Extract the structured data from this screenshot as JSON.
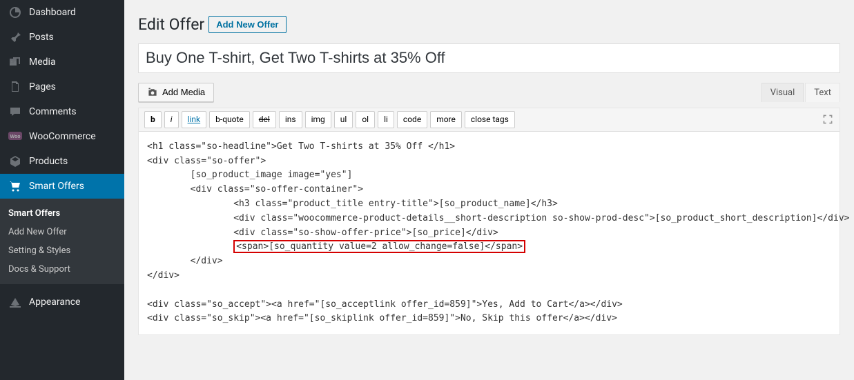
{
  "sidebar": {
    "items": [
      {
        "label": "Dashboard",
        "icon": "dashboard-icon"
      },
      {
        "label": "Posts",
        "icon": "pin-icon"
      },
      {
        "label": "Media",
        "icon": "media-icon"
      },
      {
        "label": "Pages",
        "icon": "pages-icon"
      },
      {
        "label": "Comments",
        "icon": "comments-icon"
      },
      {
        "label": "WooCommerce",
        "icon": "woo-icon"
      },
      {
        "label": "Products",
        "icon": "products-icon"
      },
      {
        "label": "Smart Offers",
        "icon": "cart-icon"
      },
      {
        "label": "Appearance",
        "icon": "appearance-icon"
      }
    ],
    "subitems": [
      {
        "label": "Smart Offers"
      },
      {
        "label": "Add New Offer"
      },
      {
        "label": "Setting & Styles"
      },
      {
        "label": "Docs & Support"
      }
    ]
  },
  "page": {
    "heading": "Edit Offer",
    "add_new": "Add New Offer",
    "title_value": "Buy One T-shirt, Get Two T-shirts at 35% Off",
    "add_media": "Add Media"
  },
  "editor": {
    "tabs": {
      "visual": "Visual",
      "text": "Text"
    },
    "quicktags": [
      "b",
      "i",
      "link",
      "b-quote",
      "del",
      "ins",
      "img",
      "ul",
      "ol",
      "li",
      "code",
      "more",
      "close tags"
    ],
    "content_lines": {
      "l1": "<h1 class=\"so-headline\">Get Two T-shirts at 35% Off </h1>",
      "l2": "<div class=\"so-offer\">",
      "l3": "        [so_product_image image=\"yes\"]",
      "l4": "        <div class=\"so-offer-container\">",
      "l5": "                <h3 class=\"product_title entry-title\">[so_product_name]</h3>",
      "l6": "                <div class=\"woocommerce-product-details__short-description so-show-prod-desc\">[so_product_short_description]</div>",
      "l7": "                <div class=\"so-show-offer-price\">[so_price]</div>",
      "l8_prefix": "                ",
      "l8_highlight": "<span>[so_quantity value=2 allow_change=false]</span>",
      "l9": "        </div>",
      "l10": "</div>",
      "l11": "",
      "l12": "<div class=\"so_accept\"><a href=\"[so_acceptlink offer_id=859]\">Yes, Add to Cart</a></div>",
      "l13": "<div class=\"so_skip\"><a href=\"[so_skiplink offer_id=859]\">No, Skip this offer</a></div>"
    }
  }
}
